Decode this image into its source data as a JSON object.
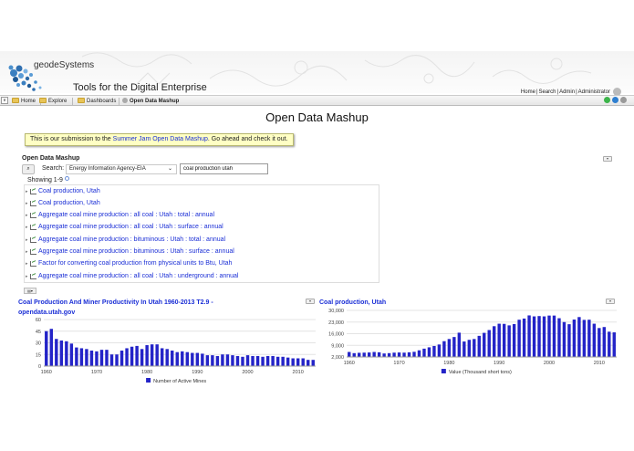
{
  "header": {
    "logo_text": "geodeSystems",
    "tagline": "Tools for the Digital Enterprise",
    "links": [
      "Home",
      "Search",
      "Admin",
      "Administrator"
    ]
  },
  "nav": {
    "items": [
      "Home",
      "Explore",
      "Dashboards",
      "Open Data Mashup"
    ]
  },
  "page": {
    "title": "Open Data Mashup",
    "banner_prefix": "This is our submission to the ",
    "banner_link": "Summer Jam Open Data Mashup",
    "banner_suffix": ". Go ahead and check it out."
  },
  "search_panel": {
    "title": "Open Data Mashup",
    "search_label": "Search:",
    "source_selected": "Energy Information Agency-EIA",
    "query_value": "coal production utah",
    "showing": "Showing 1-9",
    "results": [
      "Coal production, Utah",
      "Coal production, Utah",
      "Aggregate coal mine production : all coal : Utah : total : annual",
      "Aggregate coal mine production : all coal : Utah : surface : annual",
      "Aggregate coal mine production : bituminous : Utah : total : annual",
      "Aggregate coal mine production : bituminous : Utah : surface : annual",
      "Factor for converting coal production from physical units to Btu, Utah",
      "Aggregate coal mine production : all coal : Utah : underground : annual"
    ]
  },
  "colors": {
    "link": "#1b2fd6",
    "bar": "#2424c8",
    "banner_bg": "#ffffc4",
    "nav_bg": "#ececec"
  },
  "chart_data": [
    {
      "type": "bar",
      "title": "Coal Production And Miner Productivity In Utah 1960-2013 T2.9 - opendata.utah.gov",
      "series_name": "Number of Active Mines",
      "x": [
        1960,
        1961,
        1962,
        1963,
        1964,
        1965,
        1966,
        1967,
        1968,
        1969,
        1970,
        1971,
        1972,
        1973,
        1974,
        1975,
        1976,
        1977,
        1978,
        1979,
        1980,
        1981,
        1982,
        1983,
        1984,
        1985,
        1986,
        1987,
        1988,
        1989,
        1990,
        1991,
        1992,
        1993,
        1994,
        1995,
        1996,
        1997,
        1998,
        1999,
        2000,
        2001,
        2002,
        2003,
        2004,
        2005,
        2006,
        2007,
        2008,
        2009,
        2010,
        2011,
        2012,
        2013
      ],
      "values": [
        45,
        48,
        35,
        33,
        32,
        29,
        24,
        23,
        22,
        20,
        19,
        21,
        21,
        15,
        15,
        20,
        23,
        25,
        26,
        22,
        27,
        28,
        28,
        23,
        22,
        20,
        18,
        19,
        18,
        17,
        17,
        16,
        14,
        14,
        13,
        15,
        15,
        14,
        13,
        12,
        14,
        13,
        13,
        12,
        13,
        13,
        12,
        12,
        11,
        10,
        10,
        10,
        8,
        8
      ],
      "xticks": [
        1960,
        1970,
        1980,
        1990,
        2000,
        2010
      ],
      "yticks": [
        0,
        15,
        30,
        45,
        60
      ],
      "ylim": [
        0,
        60
      ]
    },
    {
      "type": "bar",
      "title": "Coal production, Utah",
      "series_name": "Value (Thousand short tons)",
      "x": [
        1960,
        1961,
        1962,
        1963,
        1964,
        1965,
        1966,
        1967,
        1968,
        1969,
        1970,
        1971,
        1972,
        1973,
        1974,
        1975,
        1976,
        1977,
        1978,
        1979,
        1980,
        1981,
        1982,
        1983,
        1984,
        1985,
        1986,
        1987,
        1988,
        1989,
        1990,
        1991,
        1992,
        1993,
        1994,
        1995,
        1996,
        1997,
        1998,
        1999,
        2000,
        2001,
        2002,
        2003,
        2004,
        2005,
        2006,
        2007,
        2008,
        2009,
        2010,
        2011,
        2012,
        2013
      ],
      "values": [
        5000,
        4300,
        4500,
        4600,
        4700,
        5000,
        4800,
        4100,
        4300,
        4600,
        4700,
        4600,
        4800,
        5100,
        6000,
        7000,
        7800,
        8600,
        9500,
        11500,
        12800,
        14000,
        16600,
        11300,
        12300,
        12800,
        14700,
        16500,
        18200,
        20500,
        22000,
        21900,
        21000,
        21800,
        24400,
        25100,
        27000,
        26400,
        26600,
        26400,
        26900,
        26900,
        25300,
        23000,
        21700,
        24500,
        26000,
        24300,
        24400,
        22000,
        19400,
        20000,
        17200,
        16800
      ],
      "xticks": [
        1960,
        1970,
        1980,
        1990,
        2000,
        2010
      ],
      "yticks": [
        2000,
        9000,
        16000,
        23000,
        30000
      ],
      "ylim": [
        2000,
        30000
      ]
    }
  ]
}
